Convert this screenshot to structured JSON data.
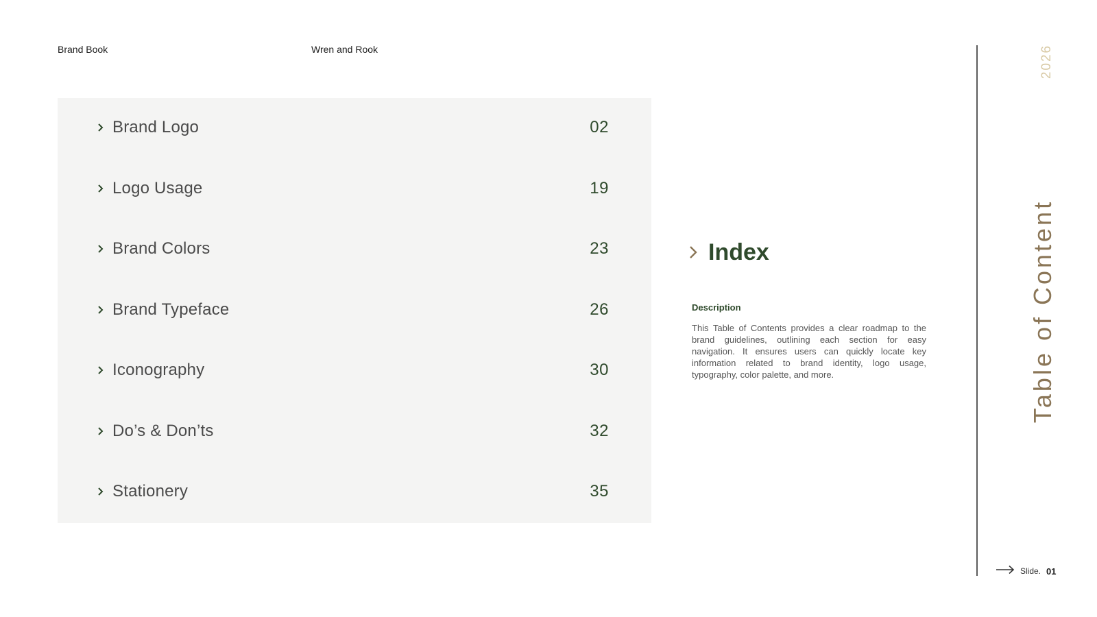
{
  "header": {
    "left": "Brand Book",
    "center": "Wren and Rook"
  },
  "toc": {
    "items": [
      {
        "label": "Brand Logo",
        "page": "02"
      },
      {
        "label": "Logo Usage",
        "page": "19"
      },
      {
        "label": "Brand Colors",
        "page": "23"
      },
      {
        "label": "Brand Typeface",
        "page": "26"
      },
      {
        "label": "Iconography",
        "page": "30"
      },
      {
        "label": "Do’s & Don’ts",
        "page": "32"
      },
      {
        "label": "Stationery",
        "page": "35"
      }
    ]
  },
  "index": {
    "title": "Index",
    "description_title": "Description",
    "description": "This Table of Contents provides a clear roadmap to the brand guidelines, outlining each section for easy navigation. It ensures users can quickly locate key information related to brand identity, logo usage, typography, color palette, and more."
  },
  "side": {
    "year": "2026",
    "title": "Table of Content"
  },
  "footer": {
    "slide_label": "Slide.",
    "slide_number": "01"
  },
  "colors": {
    "panel_bg": "#f4f4f3",
    "accent_green": "#2f4a2c",
    "accent_brown": "#8a7556",
    "year_tan": "#d8c9a4"
  }
}
